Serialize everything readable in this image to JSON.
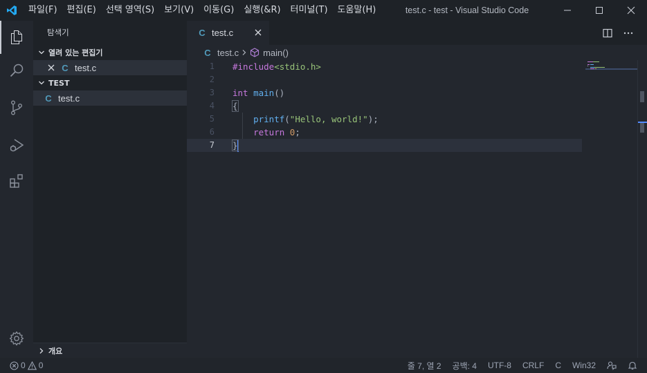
{
  "titlebar": {
    "menu": [
      "파일(F)",
      "편집(E)",
      "선택 영역(S)",
      "보기(V)",
      "이동(G)",
      "실행(&R)",
      "터미널(T)",
      "도움말(H)"
    ],
    "title": "test.c - test - Visual Studio Code"
  },
  "sidebar": {
    "title": "탐색기",
    "open_editors": {
      "header": "열려 있는 편집기",
      "files": [
        {
          "name": "test.c",
          "icon": "C"
        }
      ]
    },
    "folder": {
      "header": "TEST",
      "files": [
        {
          "name": "test.c",
          "icon": "C"
        }
      ]
    },
    "outline_header": "개요"
  },
  "editor": {
    "tab": {
      "label": "test.c",
      "icon": "C"
    },
    "breadcrumb": {
      "file": "test.c",
      "symbol": "main()",
      "file_icon": "C"
    },
    "line_numbers": [
      "1",
      "2",
      "3",
      "4",
      "5",
      "6",
      "7"
    ],
    "code": {
      "l1_directive": "#include",
      "l1_header": "<stdio.h>",
      "l3_type": "int",
      "l3_fn": "main",
      "l3_rest": "()",
      "l4": "{",
      "l5_indent": "    ",
      "l5_fn": "printf",
      "l5_open": "(",
      "l5_str": "\"Hello, world!\"",
      "l5_close": ");",
      "l6_indent": "    ",
      "l6_kw": "return",
      "l6_num": "0",
      "l6_end": ";",
      "l7": "}"
    }
  },
  "statusbar": {
    "errors": "0",
    "warnings": "0",
    "position": "줄 7, 열 2",
    "spaces": "공백: 4",
    "encoding": "UTF-8",
    "eol": "CRLF",
    "language": "C",
    "platform": "Win32"
  },
  "colors": {
    "accent": "#528bff",
    "vscode_blue": "#23a9f2",
    "c_icon": "#519aba"
  },
  "icons": {
    "activity": [
      "files-icon",
      "search-icon",
      "source-control-icon",
      "run-debug-icon",
      "extensions-icon",
      "gear-icon"
    ],
    "status": [
      "error-icon",
      "warning-icon",
      "feedback-icon",
      "bell-icon"
    ]
  }
}
